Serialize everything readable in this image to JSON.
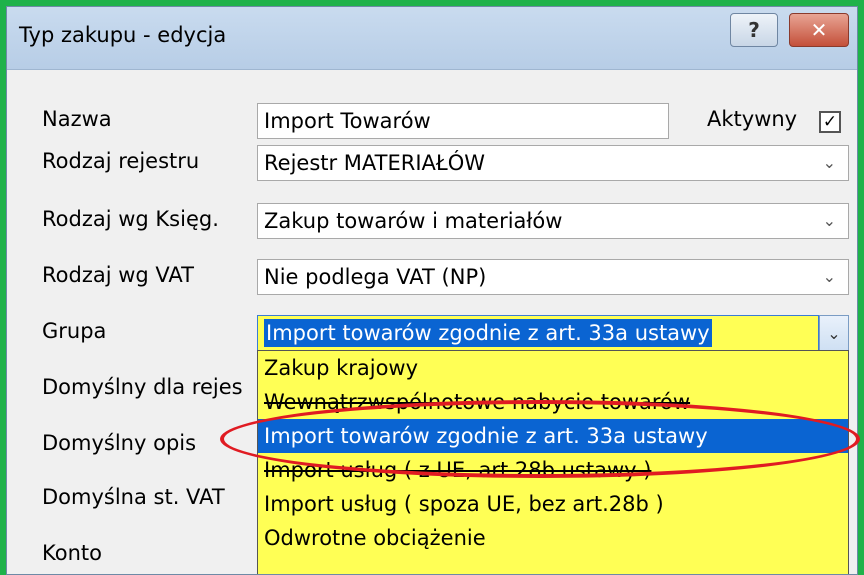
{
  "window": {
    "title": "Typ zakupu - edycja",
    "help_label": "?",
    "close_label": "✕"
  },
  "form": {
    "nazwa_label": "Nazwa",
    "nazwa_value": "Import Towarów",
    "aktywny_label": "Aktywny",
    "aktywny_checked": true,
    "rodzaj_rejestru_label": "Rodzaj rejestru",
    "rodzaj_rejestru_value": "Rejestr MATERIAŁÓW",
    "rodzaj_ksieg_label": "Rodzaj wg Księg.",
    "rodzaj_ksieg_value": "Zakup towarów i materiałów",
    "rodzaj_vat_label": "Rodzaj wg VAT",
    "rodzaj_vat_value": "Nie podlega VAT (NP)",
    "grupa_label": "Grupa",
    "grupa_value": "Import towarów zgodnie z art. 33a ustawy",
    "domyslny_rejestr_label": "Domyślny dla rejes",
    "domyslny_opis_label": "Domyślny opis",
    "domyslna_vat_label": "Domyślna st. VAT",
    "konto_label": "Konto"
  },
  "dropdown": {
    "options": [
      "Zakup krajowy",
      "Wewnątrzwspólnotowe nabycie towarów",
      "Import towarów zgodnie z art. 33a ustawy",
      "Import usług ( z UE, art.28b ustawy )",
      "Import usług ( spoza UE, bez art.28b )",
      "Odwrotne obciążenie"
    ],
    "selected_index": 2
  },
  "colors": {
    "highlight_yellow": "#ffff55",
    "selection_blue": "#0a64d2",
    "annotation_red": "#e01b22"
  }
}
